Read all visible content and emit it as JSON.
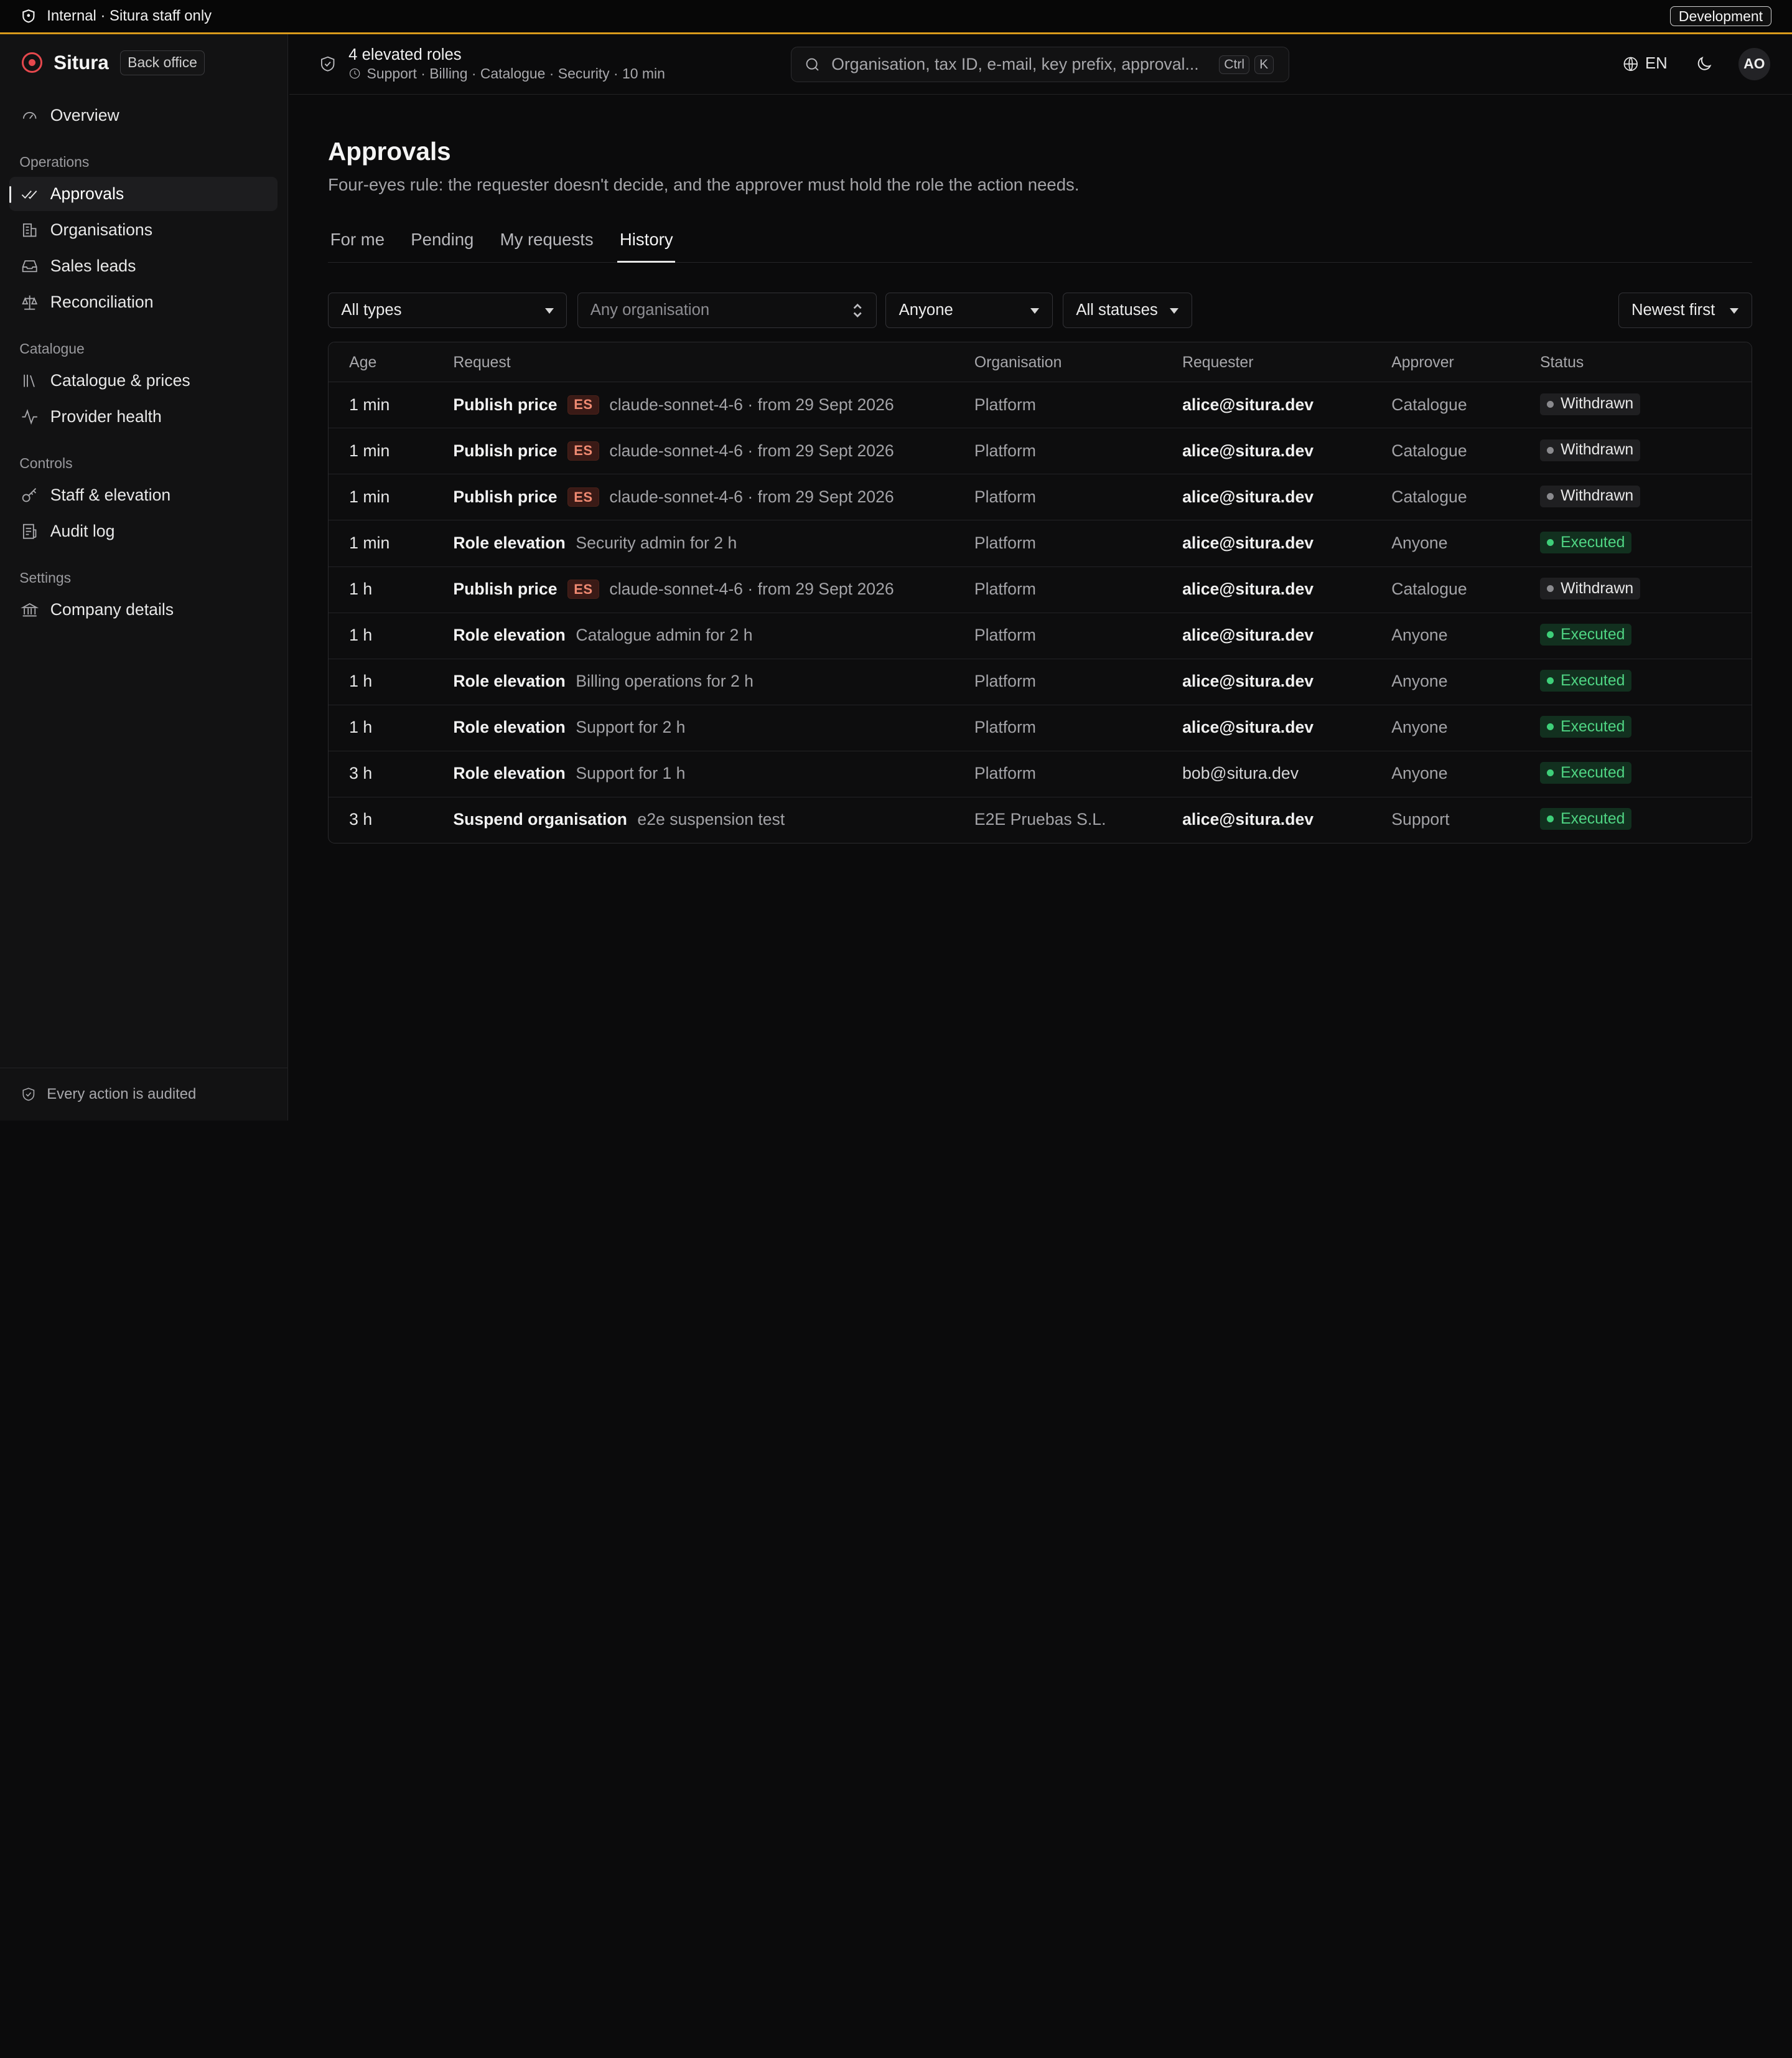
{
  "banner": {
    "text": "Internal · Situra staff only",
    "env": "Development"
  },
  "brand": {
    "name": "Situra",
    "tag": "Back office"
  },
  "nav": {
    "overview": "Overview",
    "sections": {
      "operations": "Operations",
      "catalogue": "Catalogue",
      "controls": "Controls",
      "settings": "Settings"
    },
    "approvals": "Approvals",
    "organisations": "Organisations",
    "sales_leads": "Sales leads",
    "reconciliation": "Reconciliation",
    "catalogue_prices": "Catalogue & prices",
    "provider_health": "Provider health",
    "staff_elevation": "Staff & elevation",
    "audit_log": "Audit log",
    "company_details": "Company details"
  },
  "sidebar_footer": "Every action is audited",
  "header": {
    "elevated_title": "4 elevated roles",
    "elevated_detail": "Support · Billing · Catalogue · Security · 10 min",
    "search_placeholder": "Organisation, tax ID, e-mail, key prefix, approval...",
    "kbd_ctrl": "Ctrl",
    "kbd_k": "K",
    "lang": "EN",
    "avatar": "AO"
  },
  "page": {
    "title": "Approvals",
    "subtitle": "Four-eyes rule: the requester doesn't decide, and the approver must hold the role the action needs.",
    "tabs": [
      "For me",
      "Pending",
      "My requests",
      "History"
    ],
    "active_tab": "History"
  },
  "filters": {
    "type": "All types",
    "organisation_placeholder": "Any organisation",
    "requester": "Anyone",
    "status": "All statuses",
    "sort": "Newest first"
  },
  "table": {
    "columns": [
      "Age",
      "Request",
      "Organisation",
      "Requester",
      "Approver",
      "Status"
    ],
    "rows": [
      {
        "age": "1 min",
        "type": "Publish price",
        "badge": "ES",
        "detail": "claude-sonnet-4-6 · from 29 Sept 2026",
        "org": "Platform",
        "requester": "alice@situra.dev",
        "approver": "Catalogue",
        "status": "Withdrawn"
      },
      {
        "age": "1 min",
        "type": "Publish price",
        "badge": "ES",
        "detail": "claude-sonnet-4-6 · from 29 Sept 2026",
        "org": "Platform",
        "requester": "alice@situra.dev",
        "approver": "Catalogue",
        "status": "Withdrawn"
      },
      {
        "age": "1 min",
        "type": "Publish price",
        "badge": "ES",
        "detail": "claude-sonnet-4-6 · from 29 Sept 2026",
        "org": "Platform",
        "requester": "alice@situra.dev",
        "approver": "Catalogue",
        "status": "Withdrawn"
      },
      {
        "age": "1 min",
        "type": "Role elevation",
        "badge": "",
        "detail": "Security admin for 2 h",
        "org": "Platform",
        "requester": "alice@situra.dev",
        "approver": "Anyone",
        "status": "Executed"
      },
      {
        "age": "1 h",
        "type": "Publish price",
        "badge": "ES",
        "detail": "claude-sonnet-4-6 · from 29 Sept 2026",
        "org": "Platform",
        "requester": "alice@situra.dev",
        "approver": "Catalogue",
        "status": "Withdrawn"
      },
      {
        "age": "1 h",
        "type": "Role elevation",
        "badge": "",
        "detail": "Catalogue admin for 2 h",
        "org": "Platform",
        "requester": "alice@situra.dev",
        "approver": "Anyone",
        "status": "Executed"
      },
      {
        "age": "1 h",
        "type": "Role elevation",
        "badge": "",
        "detail": "Billing operations for 2 h",
        "org": "Platform",
        "requester": "alice@situra.dev",
        "approver": "Anyone",
        "status": "Executed"
      },
      {
        "age": "1 h",
        "type": "Role elevation",
        "badge": "",
        "detail": "Support for 2 h",
        "org": "Platform",
        "requester": "alice@situra.dev",
        "approver": "Anyone",
        "status": "Executed"
      },
      {
        "age": "3 h",
        "type": "Role elevation",
        "badge": "",
        "detail": "Support for 1 h",
        "org": "Platform",
        "requester": "bob@situra.dev",
        "approver": "Anyone",
        "status": "Executed"
      },
      {
        "age": "3 h",
        "type": "Suspend organisation",
        "badge": "",
        "detail": "e2e suspension test",
        "org": "E2E Pruebas S.L.",
        "requester": "alice@situra.dev",
        "approver": "Support",
        "status": "Executed"
      }
    ]
  },
  "colors": {
    "banner_accent": "#d99a1c",
    "brand_red": "#e5484d",
    "executed_green": "#4fd483",
    "es_badge": "#f08a72"
  }
}
